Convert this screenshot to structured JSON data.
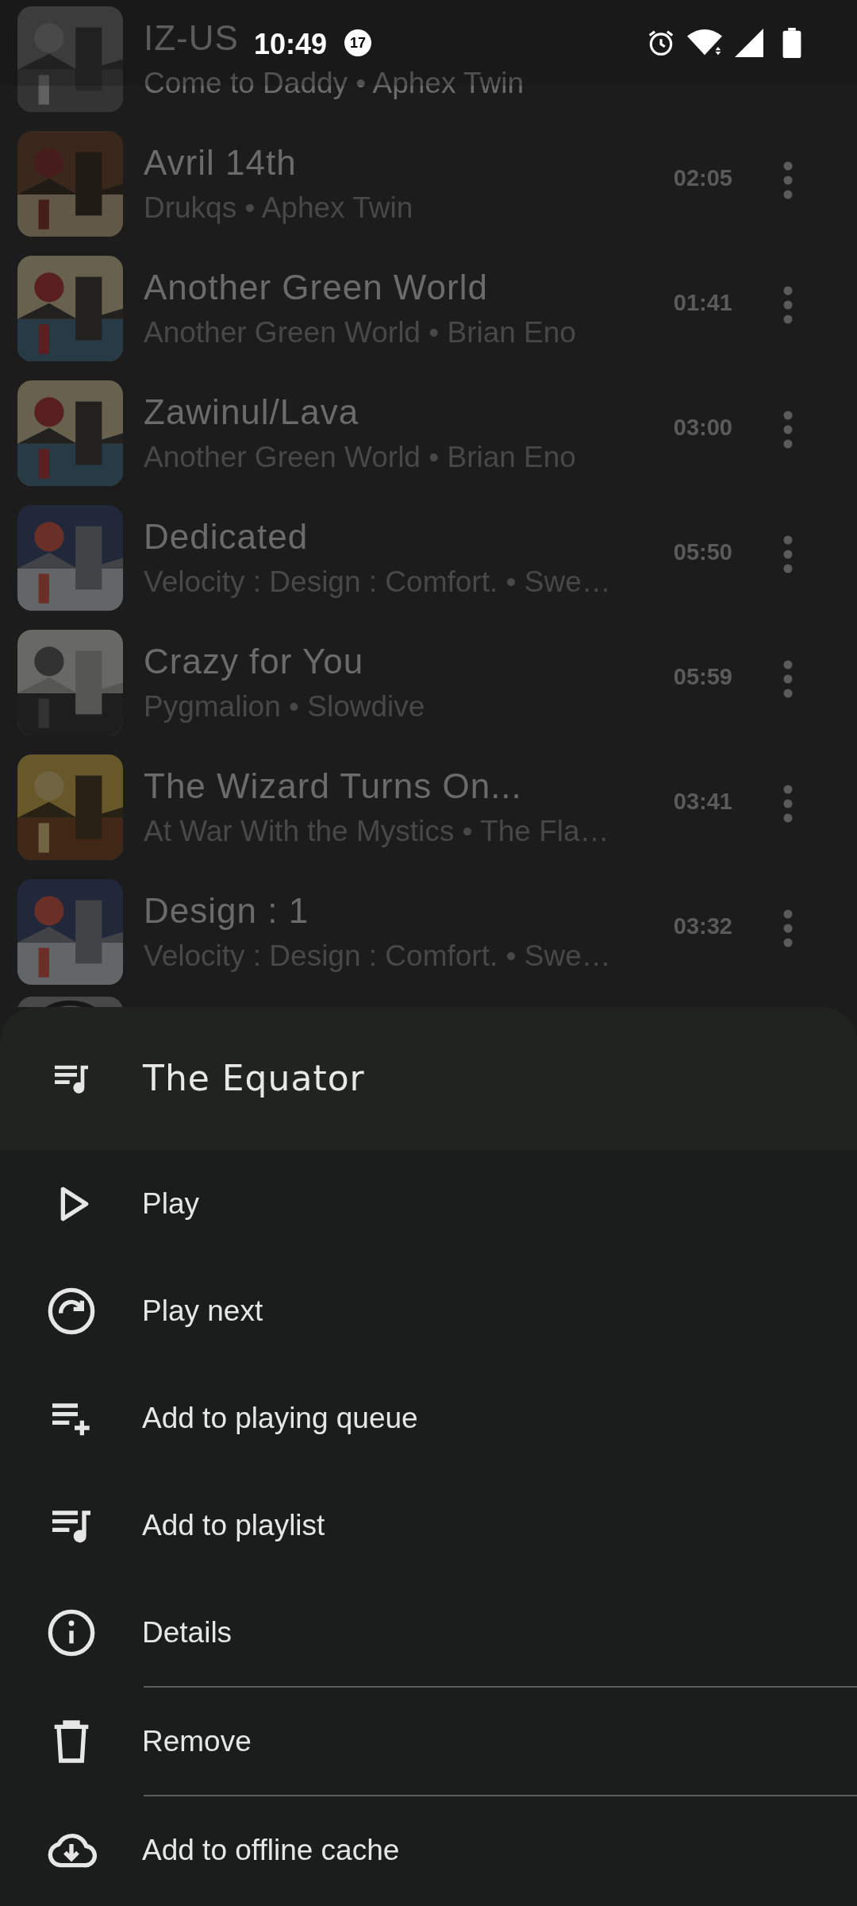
{
  "status_bar": {
    "time": "10:49",
    "notification_count": "17"
  },
  "tracks": [
    {
      "title": "IZ-US",
      "subtitle": "Come to Daddy • Aphex Twin"
    },
    {
      "title": "Avril 14th",
      "subtitle": "Drukqs • Aphex Twin",
      "duration": "02:05"
    },
    {
      "title": "Another Green World",
      "subtitle": "Another Green World • Brian Eno",
      "duration": "01:41"
    },
    {
      "title": "Zawinul/Lava",
      "subtitle": "Another Green World • Brian Eno",
      "duration": "03:00"
    },
    {
      "title": "Dedicated",
      "subtitle": "Velocity : Design : Comfort. • Swe…",
      "duration": "05:50"
    },
    {
      "title": "Crazy for You",
      "subtitle": "Pygmalion • Slowdive",
      "duration": "05:59"
    },
    {
      "title": "The Wizard Turns On...",
      "subtitle": "At War With the Mystics • The Fla…",
      "duration": "03:41"
    },
    {
      "title": "Design : 1",
      "subtitle": "Velocity : Design : Comfort. • Swe…",
      "duration": "03:32"
    }
  ],
  "sheet": {
    "title": "The Equator",
    "actions": [
      {
        "kind": "play",
        "label": "Play",
        "divider_after": false
      },
      {
        "kind": "play_next",
        "label": "Play next",
        "divider_after": false
      },
      {
        "kind": "queue",
        "label": "Add to playing queue",
        "divider_after": false
      },
      {
        "kind": "playlist",
        "label": "Add to playlist",
        "divider_after": false
      },
      {
        "kind": "details",
        "label": "Details",
        "divider_after": true
      },
      {
        "kind": "remove",
        "label": "Remove",
        "divider_after": true
      },
      {
        "kind": "cache",
        "label": "Add to offline cache",
        "divider_after": false
      }
    ]
  }
}
